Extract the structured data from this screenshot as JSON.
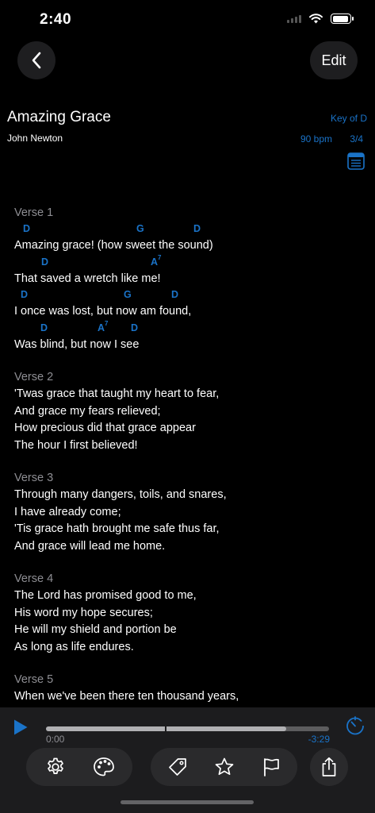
{
  "status_bar": {
    "time": "2:40"
  },
  "nav": {
    "edit_label": "Edit"
  },
  "song": {
    "title": "Amazing Grace",
    "author": "John Newton",
    "key": "Key of D",
    "bpm": "90 bpm",
    "time_signature": "3/4"
  },
  "sections": [
    {
      "label": "Verse 1",
      "lines": [
        {
          "chords": [
            {
              "name": "D",
              "sup": ""
            },
            {
              "name": "G",
              "sup": ""
            },
            {
              "name": "D",
              "sup": ""
            }
          ],
          "text": "Amazing grace! (how sweet the sound)"
        },
        {
          "chords": [
            {
              "name": "D",
              "sup": ""
            },
            {
              "name": "A",
              "sup": "7"
            }
          ],
          "text": "That saved a wretch like me!"
        },
        {
          "chords": [
            {
              "name": "D",
              "sup": ""
            },
            {
              "name": "G",
              "sup": ""
            },
            {
              "name": "D",
              "sup": ""
            }
          ],
          "text": "I once was lost, but now am found,"
        },
        {
          "chords": [
            {
              "name": "D",
              "sup": ""
            },
            {
              "name": "A",
              "sup": "7"
            },
            {
              "name": "D",
              "sup": ""
            }
          ],
          "text": "Was blind, but now I see"
        }
      ]
    },
    {
      "label": "Verse 2",
      "lines": [
        {
          "text": "'Twas grace that taught my heart to fear,"
        },
        {
          "text": "And grace my fears relieved;"
        },
        {
          "text": "How precious did that grace appear"
        },
        {
          "text": "The hour I first believed!"
        }
      ]
    },
    {
      "label": "Verse 3",
      "lines": [
        {
          "text": "Through many dangers, toils, and snares,"
        },
        {
          "text": "I have already come;"
        },
        {
          "text": "'Tis grace hath brought me safe thus far,"
        },
        {
          "text": "And grace will lead me home."
        }
      ]
    },
    {
      "label": "Verse 4",
      "lines": [
        {
          "text": "The Lord has promised good to me,"
        },
        {
          "text": "His word my hope secures;"
        },
        {
          "text": "He will my shield and portion be"
        },
        {
          "text": "As long as life endures."
        }
      ]
    },
    {
      "label": "Verse 5",
      "lines": [
        {
          "text": "When we've been there ten thousand years,"
        }
      ]
    }
  ],
  "player": {
    "elapsed": "0:00",
    "remaining": "-3:29",
    "buffered_fraction": 0.85,
    "played_fraction": 0
  },
  "colors": {
    "accent": "#1a73c8",
    "background": "#000000",
    "panel": "#1c1c1e"
  },
  "icons": {
    "nav": [
      "chevron-left-icon"
    ],
    "toolbar": [
      "gear-icon",
      "palette-icon",
      "tag-icon",
      "star-icon",
      "flag-icon",
      "share-icon"
    ]
  }
}
